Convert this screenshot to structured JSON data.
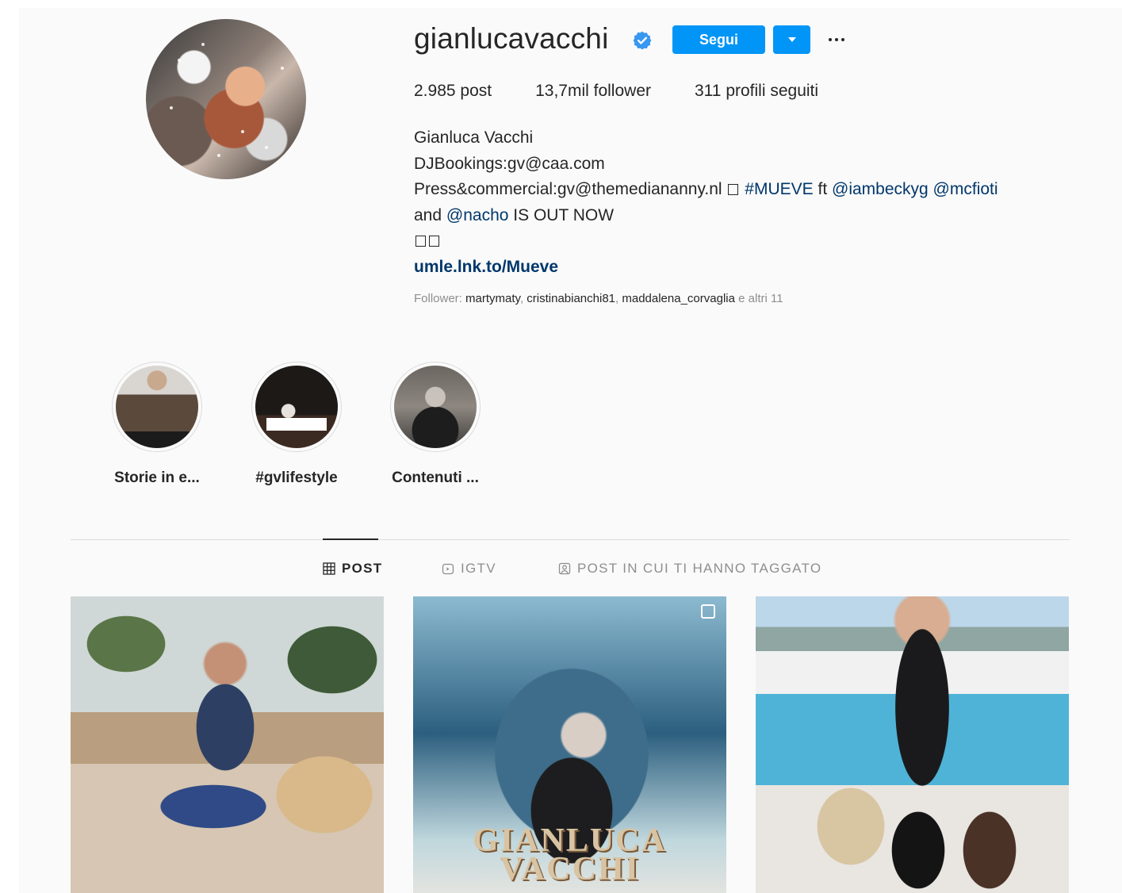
{
  "profile": {
    "username": "gianlucavacchi",
    "follow_label": "Segui",
    "stats": {
      "posts": "2.985 post",
      "followers": "13,7mil follower",
      "following": "311 profili seguiti"
    },
    "bio": {
      "name": "Gianluca Vacchi",
      "line1": "DJBookings:gv@caa.com",
      "line2_text": "Press&commercial:gv@themediananny.nl",
      "line2_hashtag": "#MUEVE",
      "line2_ft": "ft",
      "line2_mention1": "@iambeckyg",
      "line2_mention2": "@mcfioti",
      "line3_and": "and",
      "line3_mention": "@nacho",
      "line3_rest": "IS OUT NOW",
      "website": "umle.lnk.to/Mueve"
    },
    "followed_by": {
      "prefix": "Follower:",
      "names": [
        "martymaty",
        "cristinabianchi81",
        "maddalena_corvaglia"
      ],
      "suffix": "e altri 11"
    }
  },
  "highlights": [
    {
      "label": "Storie in e..."
    },
    {
      "label": "#gvlifestyle"
    },
    {
      "label": "Contenuti ..."
    }
  ],
  "tabs": [
    {
      "label": "POST",
      "icon": "grid-icon",
      "active": true
    },
    {
      "label": "IGTV",
      "icon": "igtv-icon",
      "active": false
    },
    {
      "label": "POST IN CUI TI HANNO TAGGATO",
      "icon": "tagged-icon",
      "active": false
    }
  ],
  "posts": [
    {
      "overlay_text": ""
    },
    {
      "overlay_text": "GIANLUCA VACCHI"
    },
    {
      "overlay_text": ""
    }
  ],
  "colors": {
    "accent": "#0095f6",
    "link": "#00376b",
    "background": "#fafafa"
  }
}
